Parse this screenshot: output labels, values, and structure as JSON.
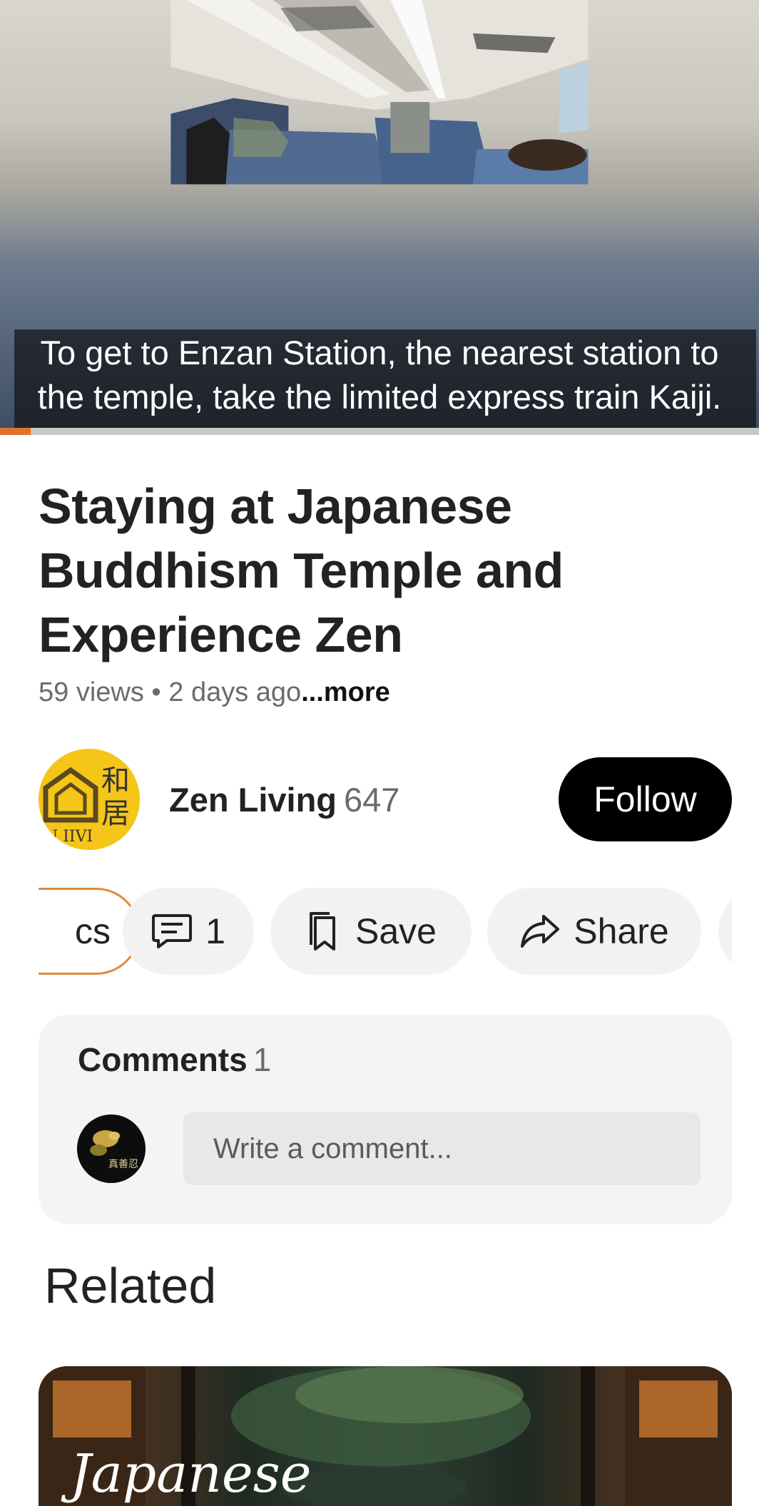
{
  "video": {
    "subtitle_line1": "To get to Enzan Station, the nearest station to",
    "subtitle_line2": "the temple, take the limited express train Kaiji.",
    "progress": 0.04,
    "progress_color": "#e0732c"
  },
  "title": "Staying at Japanese Buddhism Temple and Experience Zen",
  "meta": {
    "stats": "59 views • 2 days ago",
    "more": "...more"
  },
  "channel": {
    "name": "Zen Living",
    "subscribers": "647",
    "avatar_text": "N IIVI",
    "follow_label": "Follow"
  },
  "actions": {
    "topics_label": "cs",
    "comments_count": "1",
    "save_label": "Save",
    "share_label": "Share"
  },
  "comments": {
    "heading": "Comments",
    "count": "1",
    "placeholder": "Write a comment..."
  },
  "related": {
    "heading": "Related",
    "first_thumb_text": "Japanese"
  }
}
